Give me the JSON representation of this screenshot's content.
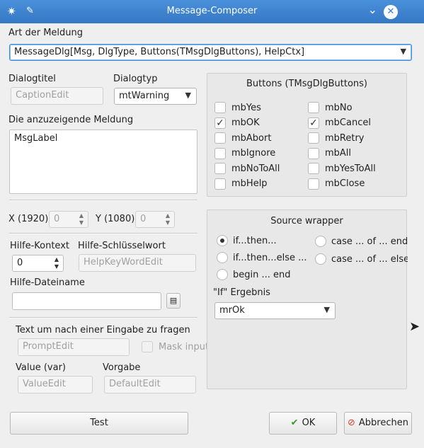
{
  "window": {
    "title": "Message-Composer",
    "close_glyph": "✕",
    "minimize_glyph": "⌄"
  },
  "art": {
    "label": "Art der Meldung",
    "value": "MessageDlg[Msg, DlgType, Buttons(TMsgDlgButtons), HelpCtx]"
  },
  "dialog": {
    "title_label": "Dialogtitel",
    "title_placeholder": "CaptionEdit",
    "type_label": "Dialogtyp",
    "type_value": "mtWarning"
  },
  "message": {
    "label": "Die anzuzeigende Meldung",
    "value": "MsgLabel"
  },
  "position": {
    "x_label": "X (1920)",
    "x_value": "0",
    "y_label": "Y (1080)",
    "y_value": "0"
  },
  "help": {
    "context_label": "Hilfe-Kontext",
    "context_value": "0",
    "keyword_label": "Hilfe-Schlüsselwort",
    "keyword_placeholder": "HelpKeyWordEdit",
    "file_label": "Hilfe-Dateiname",
    "file_value": ""
  },
  "prompt": {
    "label": "Text um nach einer Eingabe zu fragen",
    "placeholder": "PromptEdit",
    "mask_label": "Mask input",
    "value_label": "Value (var)",
    "value_placeholder": "ValueEdit",
    "default_label": "Vorgabe",
    "default_placeholder": "DefaultEdit"
  },
  "buttons_group": {
    "title": "Buttons (TMsgDlgButtons)",
    "items": [
      {
        "label": "mbYes",
        "checked": false
      },
      {
        "label": "mbNo",
        "checked": false
      },
      {
        "label": "mbOK",
        "checked": true
      },
      {
        "label": "mbCancel",
        "checked": true
      },
      {
        "label": "mbAbort",
        "checked": false
      },
      {
        "label": "mbRetry",
        "checked": false
      },
      {
        "label": "mbIgnore",
        "checked": false
      },
      {
        "label": "mbAll",
        "checked": false
      },
      {
        "label": "mbNoToAll",
        "checked": false
      },
      {
        "label": "mbYesToAll",
        "checked": false
      },
      {
        "label": "mbHelp",
        "checked": false
      },
      {
        "label": "mbClose",
        "checked": false
      }
    ]
  },
  "source_wrapper": {
    "title": "Source wrapper",
    "options": [
      {
        "label": "if...then...",
        "selected": true
      },
      {
        "label": "case ... of ... end;",
        "selected": false
      },
      {
        "label": "if...then...else ...",
        "selected": false
      },
      {
        "label": "case ... of ... else ...",
        "selected": false
      },
      {
        "label": "begin ... end",
        "selected": false
      }
    ],
    "if_result_label": "\"If\" Ergebnis",
    "if_result_value": "mrOk"
  },
  "footer": {
    "test_label": "Test",
    "ok_label": "OK",
    "cancel_label": "Abbrechen"
  },
  "colors": {
    "titlebar": "#3a7fcd",
    "accent": "#3d8ee8",
    "ok_icon": "#3a9a2a",
    "cancel_icon": "#d23a2a"
  }
}
